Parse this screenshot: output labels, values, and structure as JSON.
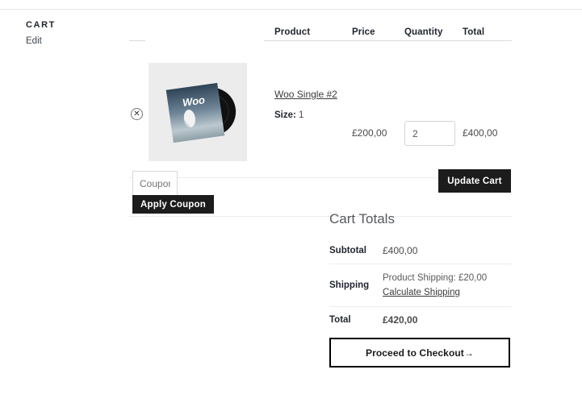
{
  "page": {
    "title": "CART",
    "edit_label": "Edit"
  },
  "cart_table": {
    "headers": {
      "product": "Product",
      "price": "Price",
      "quantity": "Quantity",
      "total": "Total"
    },
    "items": [
      {
        "remove_icon": "remove-circle-icon",
        "thumbnail_alt": "woo-single-vinyl-record-image",
        "thumbnail_label": "Woo",
        "name": "Woo Single #2",
        "variation_label": "Size:",
        "variation_value": "1",
        "price": "£200,00",
        "quantity": "2",
        "total": "£400,00"
      }
    ]
  },
  "actions": {
    "coupon_placeholder": "Coupon code",
    "apply_coupon_label": "Apply Coupon",
    "update_cart_label": "Update Cart"
  },
  "totals": {
    "title": "Cart Totals",
    "subtotal_label": "Subtotal",
    "subtotal_value": "£400,00",
    "shipping_label": "Shipping",
    "shipping_method": "Product Shipping: £20,00",
    "calculate_shipping_label": "Calculate Shipping",
    "total_label": "Total",
    "total_value": "£420,00",
    "checkout_label": "Proceed to Checkout→"
  },
  "colors": {
    "button_dark": "#1c1c1c",
    "border_light": "#ececec",
    "text_dark": "#1f2430"
  }
}
